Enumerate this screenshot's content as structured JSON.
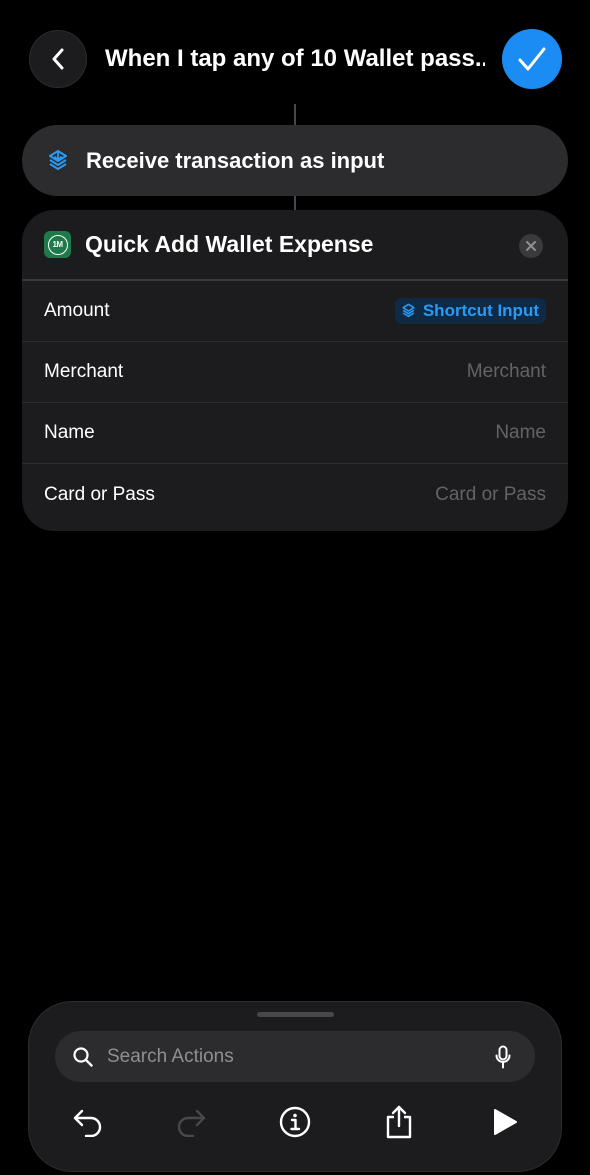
{
  "header": {
    "title": "When I tap any of 10 Wallet pass..."
  },
  "trigger": {
    "label": "Receive transaction as input"
  },
  "action": {
    "title": "Quick Add Wallet Expense",
    "app_badge": "1M",
    "params": [
      {
        "label": "Amount",
        "token": "Shortcut Input"
      },
      {
        "label": "Merchant",
        "placeholder": "Merchant"
      },
      {
        "label": "Name",
        "placeholder": "Name"
      },
      {
        "label": "Card or Pass",
        "placeholder": "Card or Pass"
      }
    ]
  },
  "search": {
    "placeholder": "Search Actions"
  },
  "toolbar": {
    "icons": [
      "undo-icon",
      "redo-icon",
      "info-icon",
      "share-icon",
      "play-icon"
    ]
  },
  "colors": {
    "accent": "#1b8cf3",
    "token_text": "#2a9bf5",
    "app_icon": "#1e7a4a"
  }
}
